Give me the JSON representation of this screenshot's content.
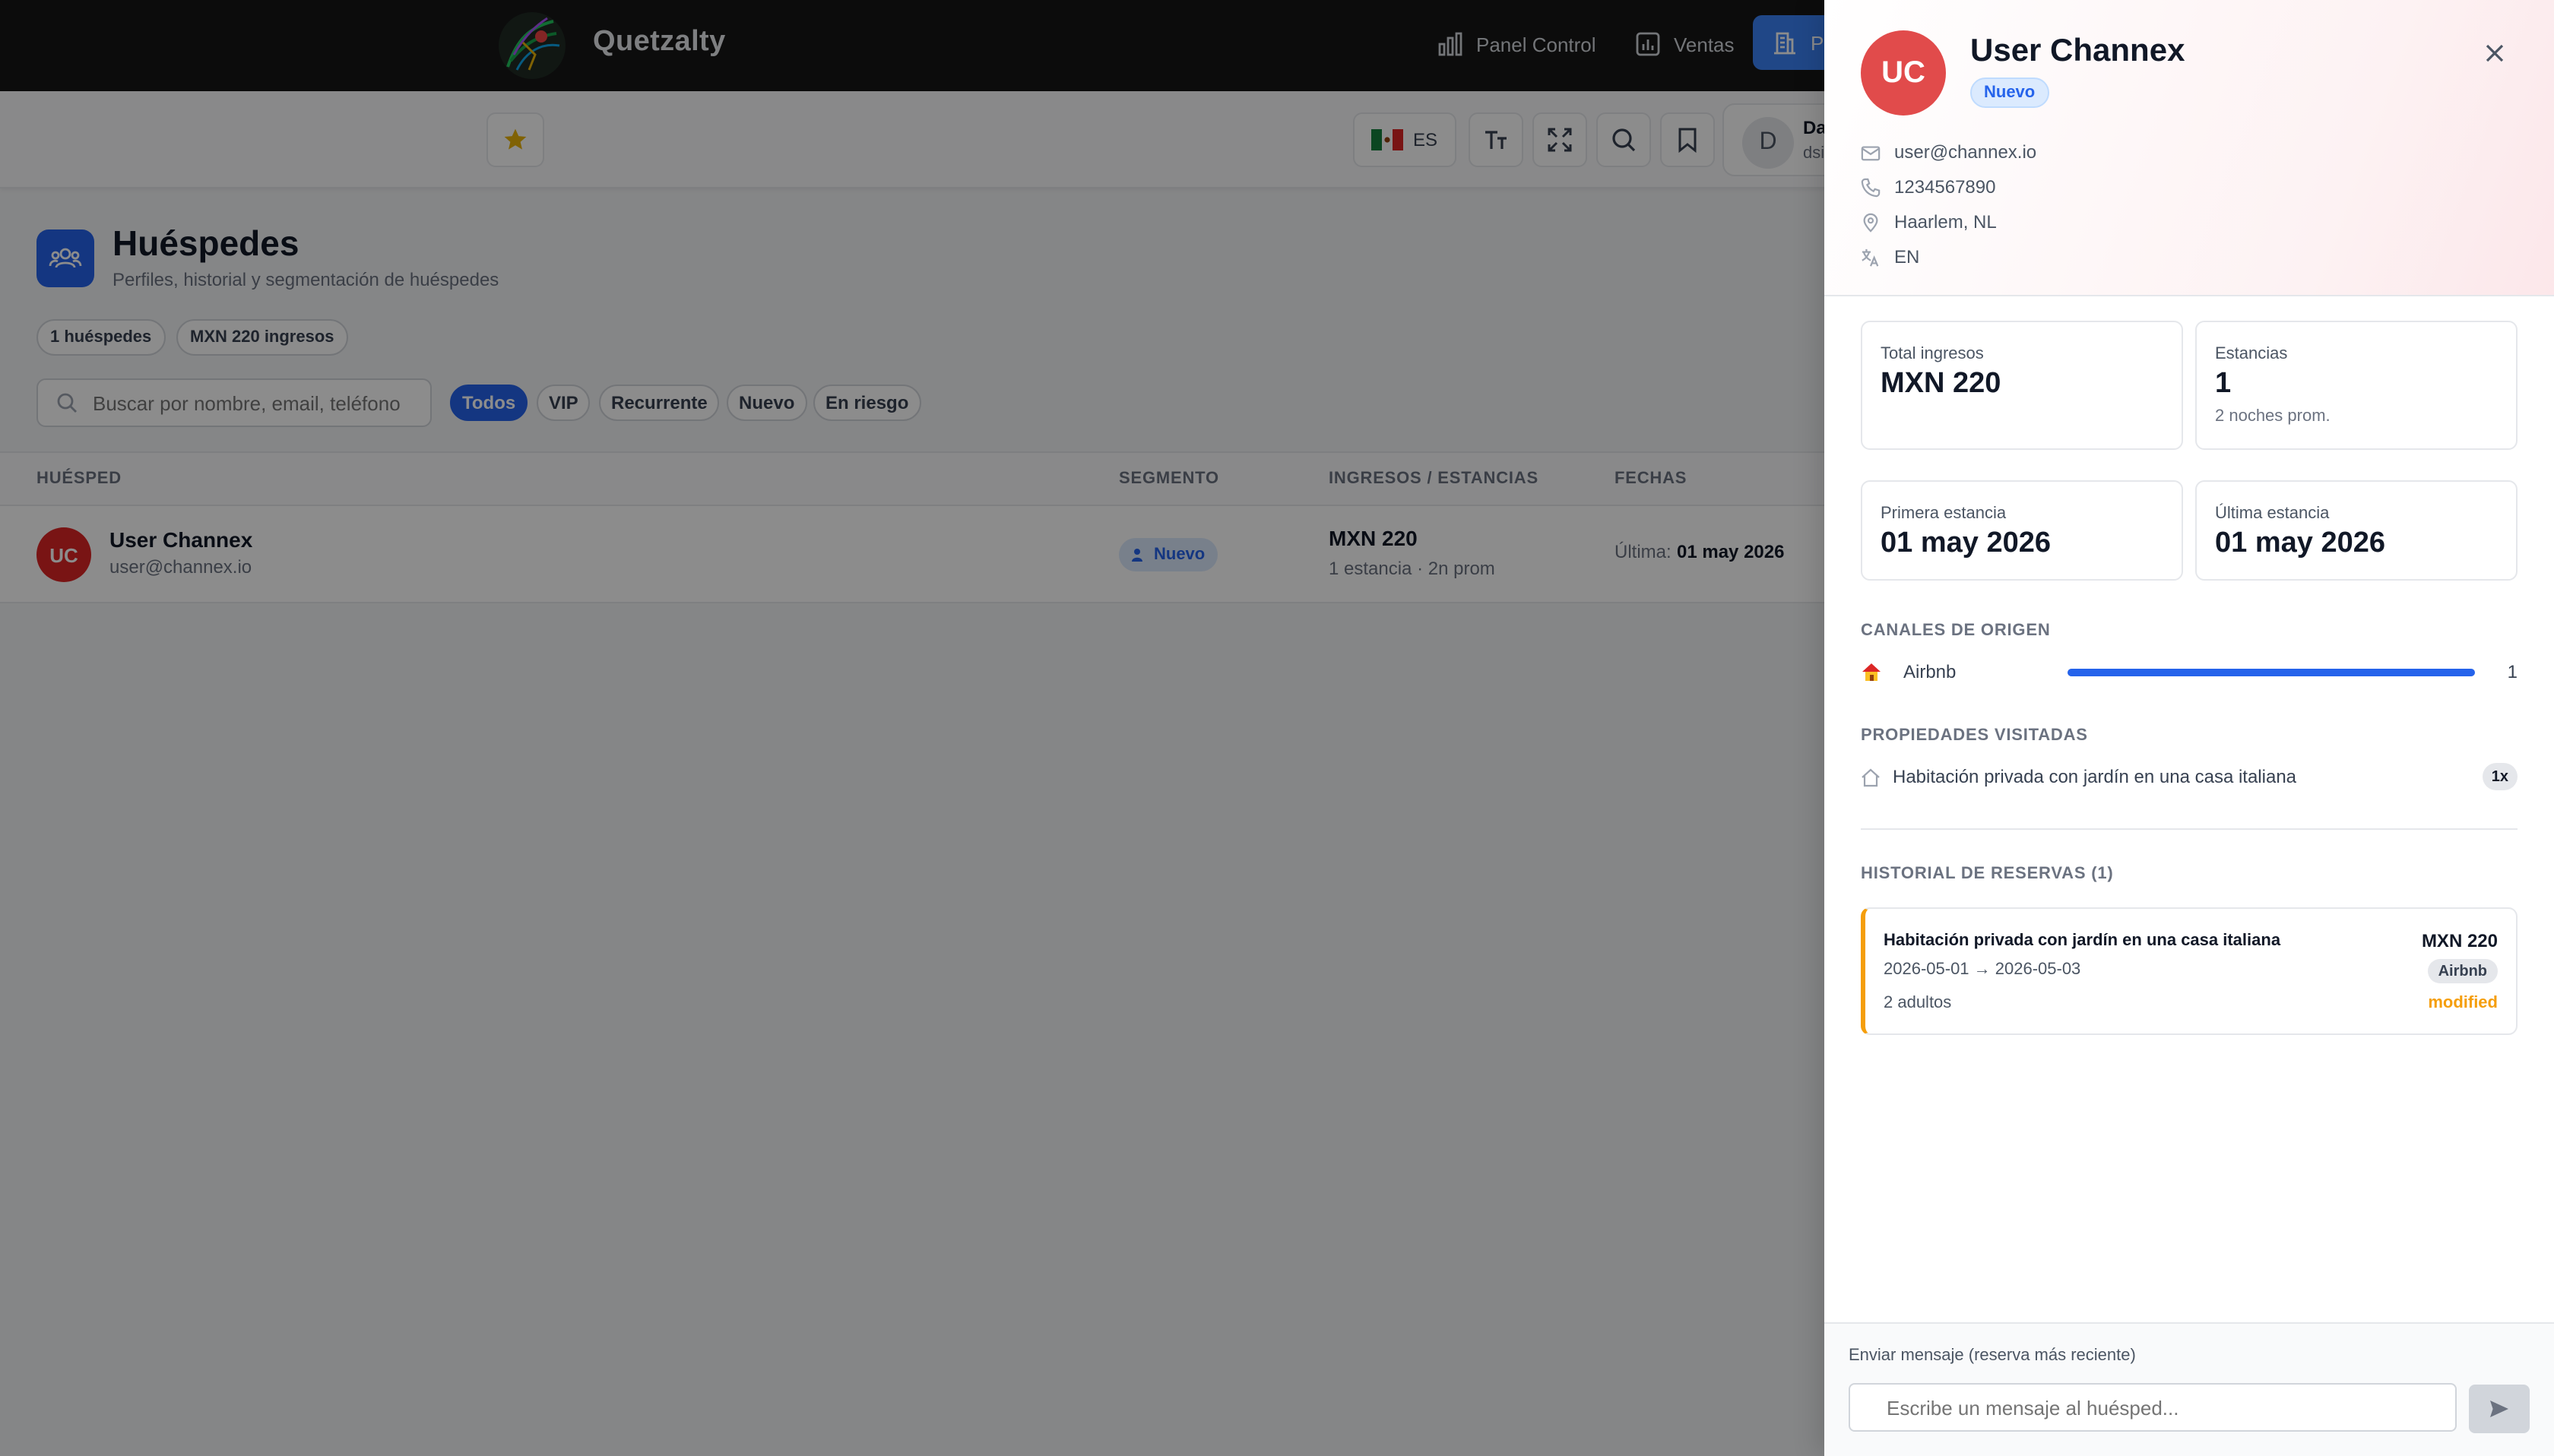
{
  "app": {
    "brand": "Quetzalty",
    "nav": {
      "panel_control": "Panel Control",
      "ventas": "Ventas",
      "active_partial": "P"
    }
  },
  "toolbar": {
    "language": "ES",
    "user_initial": "D",
    "user_name_partial": "Da",
    "user_email_partial": "dsi"
  },
  "page": {
    "title": "Huéspedes",
    "subtitle": "Perfiles, historial y segmentación de huéspedes",
    "stats": {
      "guests": "1 huéspedes",
      "income": "MXN 220 ingresos"
    },
    "search_placeholder": "Buscar por nombre, email, teléfono",
    "filters": [
      "Todos",
      "VIP",
      "Recurrente",
      "Nuevo",
      "En riesgo"
    ],
    "active_filter": "Todos"
  },
  "table": {
    "headers": {
      "guest": "HUÉSPED",
      "segment": "SEGMENTO",
      "income": "INGRESOS / ESTANCIAS",
      "dates": "FECHAS"
    },
    "rows": [
      {
        "initials": "UC",
        "name": "User Channex",
        "email": "user@channex.io",
        "segment": "Nuevo",
        "income": "MXN 220",
        "stays": "1 estancia · 2n prom",
        "date_label": "Última:",
        "date": "01 may 2026"
      }
    ]
  },
  "drawer": {
    "initials": "UC",
    "name": "User Channex",
    "badge": "Nuevo",
    "contact": {
      "email": "user@channex.io",
      "phone": "1234567890",
      "location": "Haarlem, NL",
      "language": "EN"
    },
    "stats": {
      "total_income_label": "Total ingresos",
      "total_income": "MXN 220",
      "stays_label": "Estancias",
      "stays": "1",
      "stays_sub": "2 noches prom.",
      "first_stay_label": "Primera estancia",
      "first_stay": "01 may 2026",
      "last_stay_label": "Última estancia",
      "last_stay": "01 may 2026"
    },
    "channels_title": "CANALES DE ORIGEN",
    "channels": [
      {
        "name": "Airbnb",
        "count": "1",
        "fraction": 1.0
      }
    ],
    "properties_title": "PROPIEDADES VISITADAS",
    "properties": [
      {
        "name": "Habitación privada con jardín en una casa italiana",
        "count": "1x"
      }
    ],
    "history_title": "HISTORIAL DE RESERVAS (1)",
    "reservations": [
      {
        "title": "Habitación privada con jardín en una casa italiana",
        "dates": "2026-05-01 → 2026-05-03",
        "guests": "2 adultos",
        "amount": "MXN 220",
        "channel": "Airbnb",
        "status": "modified"
      }
    ],
    "message_label": "Enviar mensaje (reserva más reciente)",
    "message_placeholder": "Escribe un mensaje al huésped..."
  },
  "colors": {
    "primary": "#2563eb",
    "avatar_red": "#e14b4b",
    "status_modified": "#f59e0b",
    "topbar": "#161616"
  }
}
